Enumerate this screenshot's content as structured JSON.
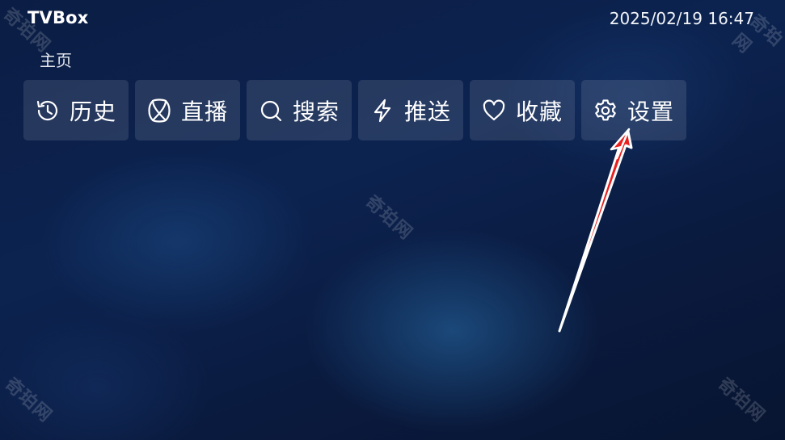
{
  "app": {
    "title": "TVBox",
    "clock": "2025/02/19 16:47"
  },
  "page": {
    "label": "主页"
  },
  "nav": {
    "items": [
      {
        "label": "历史",
        "icon": "history-icon"
      },
      {
        "label": "直播",
        "icon": "live-icon"
      },
      {
        "label": "搜索",
        "icon": "search-icon"
      },
      {
        "label": "推送",
        "icon": "push-icon"
      },
      {
        "label": "收藏",
        "icon": "favorite-icon"
      },
      {
        "label": "设置",
        "icon": "gear-icon"
      }
    ]
  },
  "watermark": {
    "text": "奇珀网"
  },
  "annotation": {
    "arrow_color": "#e8201f",
    "target": "设置"
  }
}
